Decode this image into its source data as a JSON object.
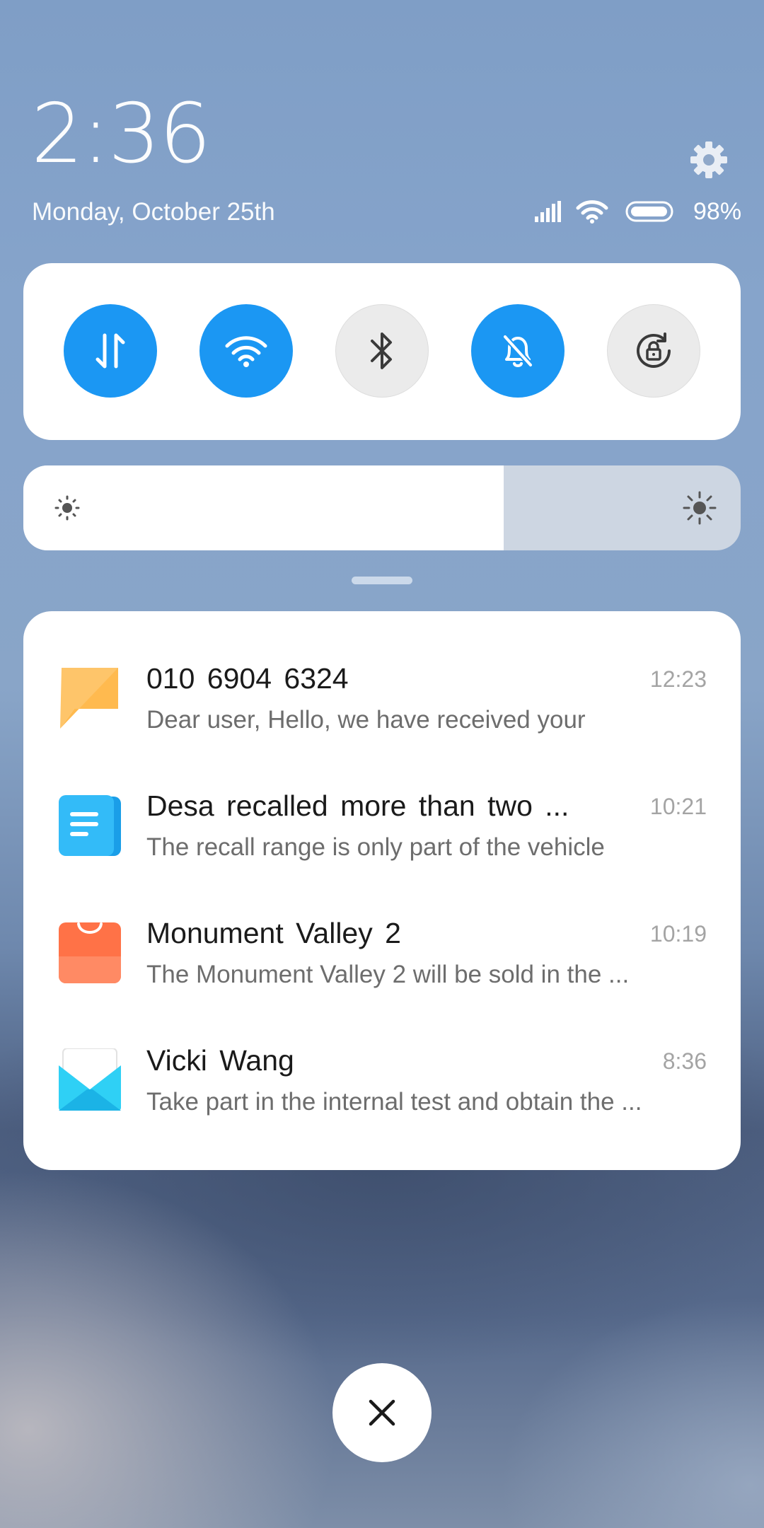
{
  "header": {
    "time": "2:36",
    "date": "Monday, October 25th",
    "battery_percent": "98%",
    "battery_level": 0.98
  },
  "quick_toggles": [
    {
      "name": "mobile-data",
      "icon": "data-transfer-arrows-icon",
      "state": "on"
    },
    {
      "name": "wifi",
      "icon": "wifi-icon",
      "state": "on"
    },
    {
      "name": "bluetooth",
      "icon": "bluetooth-icon",
      "state": "off"
    },
    {
      "name": "silent",
      "icon": "bell-off-icon",
      "state": "on"
    },
    {
      "name": "rotation-lock",
      "icon": "rotation-lock-icon",
      "state": "off"
    }
  ],
  "brightness": {
    "level": 0.67
  },
  "notifications": [
    {
      "title": "010  6904  6324",
      "body": "Dear user, Hello, we have received your",
      "time": "12:23",
      "icon": "message-icon"
    },
    {
      "title": "Desa  recalled  more  than  two  ...",
      "body": "The recall range is only part of the vehicle",
      "time": "10:21",
      "icon": "notes-icon"
    },
    {
      "title": "Monument  Valley  2",
      "body": "The Monument Valley 2 will be sold in the ...",
      "time": "10:19",
      "icon": "app-store-bag-icon"
    },
    {
      "title": "Vicki  Wang",
      "body": "Take part in the internal test and obtain the ...",
      "time": "8:36",
      "icon": "email-icon"
    }
  ],
  "colors": {
    "accent": "#1b97f3",
    "toggle_off": "#ebebeb"
  }
}
